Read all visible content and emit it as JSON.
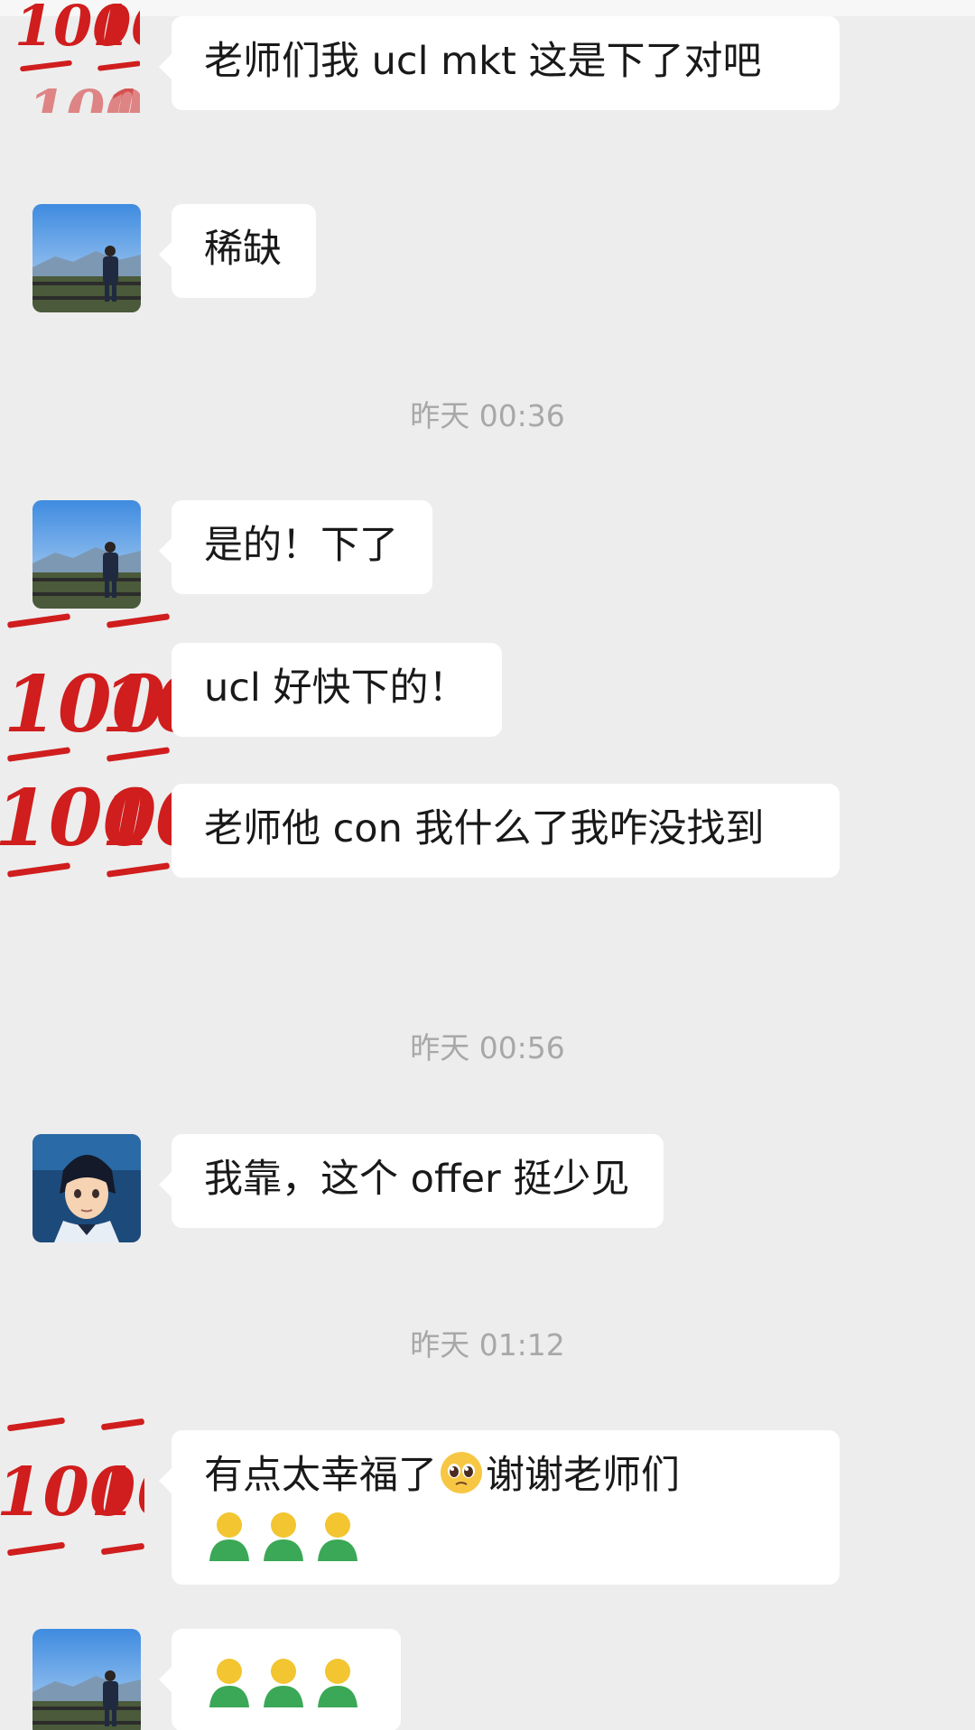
{
  "messages": [
    {
      "id": "m1",
      "sender": "hundred",
      "text": "老师们我 ucl mkt 这是下了对吧"
    },
    {
      "id": "m2",
      "sender": "landscape",
      "text": "稀缺"
    },
    {
      "id": "m3",
      "sender": "landscape",
      "text": "是的！下了"
    },
    {
      "id": "m4",
      "sender": "hundred",
      "text": "ucl 好快下的！"
    },
    {
      "id": "m5",
      "sender": "hundred",
      "text": "老师他 con 我什么了我咋没找到"
    },
    {
      "id": "m6",
      "sender": "anime",
      "text": "我靠，这个 offer 挺少见"
    },
    {
      "id": "m7",
      "sender": "hundred",
      "text_before": "有点太幸福了",
      "emoji": "pleading-face-icon",
      "text_after": "谢谢老师们",
      "trailing_emojis": [
        "person-icon",
        "person-icon",
        "person-icon"
      ]
    },
    {
      "id": "m8",
      "sender": "landscape",
      "emojis": [
        "person-icon",
        "person-icon",
        "person-icon"
      ]
    }
  ],
  "timestamps": {
    "t1": "昨天 00:36",
    "t2": "昨天 00:56",
    "t3": "昨天 01:12"
  },
  "avatar_text": {
    "hundred": "100"
  },
  "colors": {
    "background": "#ededed",
    "bubble": "#ffffff",
    "text": "#191919",
    "timestamp": "#a8a8a8",
    "hundred_red": "#d01d1d",
    "person_green": "#3aa856",
    "person_yellow": "#f2c531"
  }
}
